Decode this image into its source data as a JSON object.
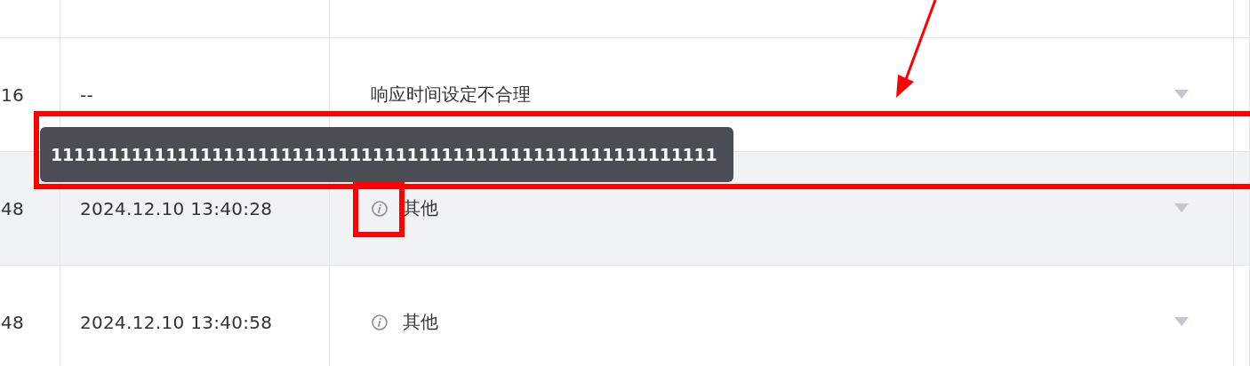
{
  "table": {
    "rows": [
      {
        "column_1": "16",
        "column_2": "--",
        "reason": "响应时间设定不合理",
        "info_icon": false,
        "selected": false
      },
      {
        "column_1": "48",
        "column_2": "2024.12.10 13:40:28",
        "reason": "其他",
        "info_icon": true,
        "selected": true
      },
      {
        "column_1": "48",
        "column_2": "2024.12.10 13:40:58",
        "reason": "其他",
        "info_icon": true,
        "selected": false
      }
    ]
  },
  "tooltip": {
    "text": "1111111111111111111111111111111111111111111111111111111111"
  }
}
